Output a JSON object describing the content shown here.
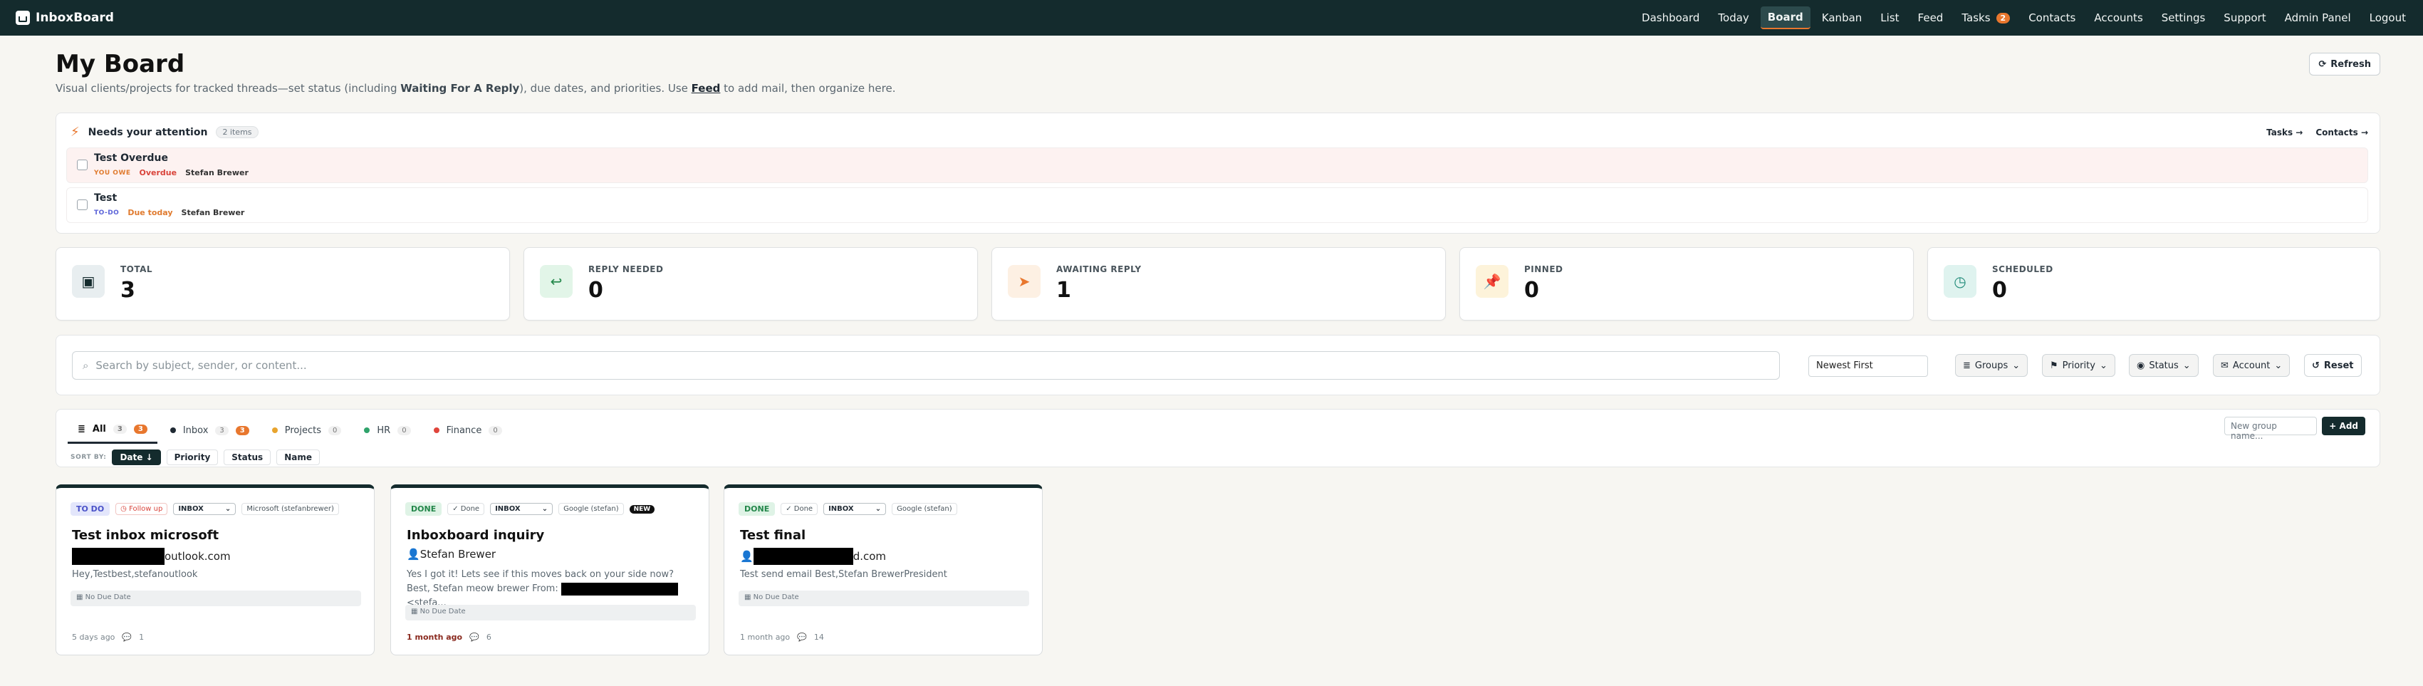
{
  "nav": {
    "brand": "InboxBoard",
    "links": [
      "Dashboard",
      "Today",
      "Board",
      "Kanban",
      "List",
      "Feed",
      "Tasks",
      "Contacts",
      "Accounts",
      "Settings",
      "Support",
      "Admin Panel",
      "Logout"
    ],
    "tasks_badge": "2",
    "active": "Board"
  },
  "header": {
    "title": "My Board",
    "subtitle_pre": "Visual clients/projects for tracked threads—set status (including ",
    "subtitle_bold": "Waiting For A Reply",
    "subtitle_mid": "), due dates, and priorities. Use ",
    "subtitle_link": "Feed",
    "subtitle_post": " to add mail, then organize here.",
    "refresh_label": "Refresh"
  },
  "attention": {
    "title": "Needs your attention",
    "count": "2 items",
    "tasks_link": "Tasks →",
    "contacts_link": "Contacts →",
    "items": [
      {
        "title": "Test Overdue",
        "tag": "YOU OWE",
        "due": "Overdue",
        "person": "Stefan Brewer"
      },
      {
        "title": "Test",
        "tag": "TO-DO",
        "due": "Due today",
        "person": "Stefan Brewer"
      }
    ]
  },
  "stats": [
    {
      "label": "TOTAL",
      "value": "3",
      "color": "#e8eef0",
      "icon_color": "#142b2d"
    },
    {
      "label": "REPLY NEEDED",
      "value": "0",
      "color": "#e2f5e8",
      "icon_color": "#23874a"
    },
    {
      "label": "AWAITING REPLY",
      "value": "1",
      "color": "#fdf0e3",
      "icon_color": "#e8772e"
    },
    {
      "label": "PINNED",
      "value": "0",
      "color": "#fdf3da",
      "icon_color": "#d79a16"
    },
    {
      "label": "SCHEDULED",
      "value": "0",
      "color": "#dff3ef",
      "icon_color": "#1f8a78"
    }
  ],
  "filter": {
    "search_placeholder": "Search by subject, sender, or content...",
    "sort_value": "Newest First",
    "groups_label": "Groups",
    "priority_label": "Priority",
    "status_label": "Status",
    "account_label": "Account",
    "reset_label": "Reset"
  },
  "groups": {
    "tabs": [
      {
        "label": "All",
        "count": "3",
        "badge": "3",
        "dot": ""
      },
      {
        "label": "Inbox",
        "count": "3",
        "badge": "3",
        "dot": "#1f2933"
      },
      {
        "label": "Projects",
        "count": "0",
        "badge": "",
        "dot": "#e8a42e"
      },
      {
        "label": "HR",
        "count": "0",
        "badge": "",
        "dot": "#2fa36b"
      },
      {
        "label": "Finance",
        "count": "0",
        "badge": "",
        "dot": "#e0453b"
      }
    ],
    "sort_by_label": "SORT BY:",
    "sort_options": [
      "Date ↓",
      "Priority",
      "Status",
      "Name"
    ],
    "new_group_placeholder": "New group name...",
    "add_label": "+ Add"
  },
  "cards": [
    {
      "status": "TO DO",
      "badge": "Follow up",
      "mailbox": "INBOX",
      "account": "Microsoft (stefanbrewer)",
      "new": "",
      "title": "Test inbox microsoft",
      "from_suffix": "outlook.com",
      "snippet": "Hey,Testbest,stefanoutlook",
      "due": "No Due Date",
      "time": "5 days ago",
      "comments": "1"
    },
    {
      "status": "DONE",
      "badge": "✓ Done",
      "mailbox": "INBOX",
      "account": "Google (stefan)",
      "new": "NEW",
      "title": "Inboxboard inquiry",
      "from_suffix": "Stefan Brewer",
      "snippet_pre": "Yes I got it! Lets see if this moves back on your side now? Best, Stefan meow brewer From:",
      "snippet_post": " <stefa...",
      "due": "No Due Date",
      "time": "1 month ago",
      "comments": "6"
    },
    {
      "status": "DONE",
      "badge": "✓ Done",
      "mailbox": "INBOX",
      "account": "Google (stefan)",
      "new": "",
      "title": "Test final",
      "from_suffix": "d.com",
      "snippet": "Test send email Best,Stefan BrewerPresident",
      "due": "No Due Date",
      "time": "1 month ago",
      "comments": "14"
    }
  ]
}
